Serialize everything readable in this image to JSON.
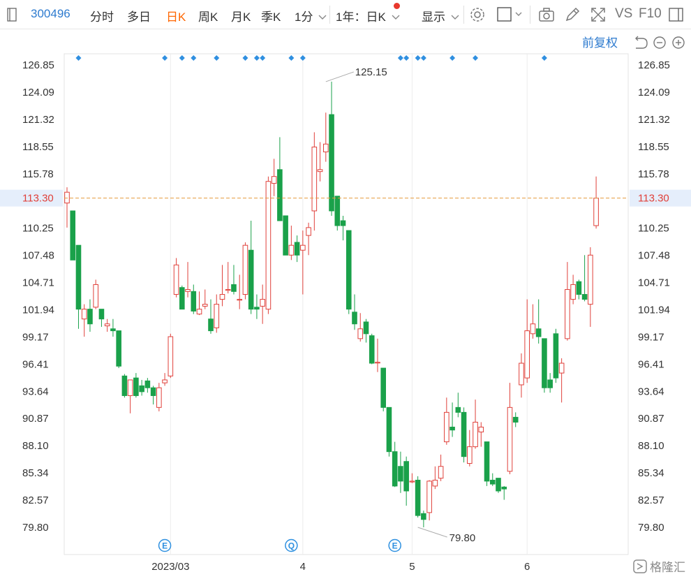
{
  "toolbar": {
    "code": "300496",
    "tabs": [
      "分时",
      "多日",
      "日K",
      "周K",
      "月K",
      "季K"
    ],
    "active_tab": "日K",
    "minute_select": "1分",
    "range_select": "1年：日K",
    "display_label": "显示",
    "vs_label": "VS",
    "f10_label": "F10",
    "icons": [
      "settings-icon",
      "checkbox-icon",
      "camera-icon",
      "pen-icon",
      "expand-icon",
      "panel-icon"
    ]
  },
  "chart_header": {
    "adjust_label": "前复权",
    "icons": [
      "undo-icon",
      "zoom-out-icon",
      "zoom-in-icon"
    ]
  },
  "colors": {
    "up": "#e0403a",
    "down": "#1aa14a",
    "price_line": "#e49b3d",
    "marker": "#2f8fe0",
    "event": "#2e90e0"
  },
  "chart_data": {
    "type": "candlestick",
    "title": "",
    "y_ticks": [
      "126.85",
      "124.09",
      "121.32",
      "118.55",
      "115.78",
      "113.30",
      "110.25",
      "107.48",
      "104.71",
      "101.94",
      "99.17",
      "96.41",
      "93.64",
      "90.87",
      "88.10",
      "85.34",
      "82.57",
      "79.80"
    ],
    "ylim": [
      79.8,
      126.85
    ],
    "x_ticks": [
      {
        "label": "2023/03",
        "index": 18
      },
      {
        "label": "4",
        "index": 41
      },
      {
        "label": "5",
        "index": 60
      },
      {
        "label": "6",
        "index": 80
      }
    ],
    "current_price": "113.30",
    "max_label": "125.15",
    "max_index": 45,
    "min_label": "79.80",
    "min_index": 61,
    "event_markers": [
      {
        "index": 17,
        "label": "E"
      },
      {
        "index": 39,
        "label": "Q"
      },
      {
        "index": 57,
        "label": "E"
      }
    ],
    "top_markers": [
      2,
      17,
      20,
      22,
      26,
      31,
      33,
      34,
      39,
      41,
      58,
      59,
      61,
      62,
      67,
      71,
      83
    ],
    "candles": [
      [
        112.8,
        113.9,
        114.4,
        110.3
      ],
      [
        112.0,
        107.0,
        112.0,
        107.0
      ],
      [
        108.5,
        102.0,
        108.5,
        100.0
      ],
      [
        101.0,
        102.0,
        102.5,
        99.2
      ],
      [
        102.0,
        100.5,
        103.0,
        99.7
      ],
      [
        102.2,
        104.5,
        105.0,
        102.0
      ],
      [
        102.0,
        101.0,
        102.0,
        100.2
      ],
      [
        100.3,
        100.5,
        101.0,
        99.7
      ],
      [
        100.0,
        99.8,
        101.0,
        99.2
      ],
      [
        99.8,
        96.2,
        99.8,
        96.0
      ],
      [
        95.2,
        93.2,
        95.4,
        93.0
      ],
      [
        93.2,
        94.8,
        94.8,
        91.4
      ],
      [
        95.0,
        93.2,
        95.5,
        93.0
      ],
      [
        94.2,
        93.6,
        94.8,
        93.2
      ],
      [
        94.7,
        94.0,
        95.0,
        93.5
      ],
      [
        94.0,
        93.2,
        94.2,
        92.3
      ],
      [
        92.0,
        94.0,
        94.5,
        91.6
      ],
      [
        94.5,
        94.8,
        95.5,
        94.2
      ],
      [
        95.2,
        99.2,
        99.5,
        95.0
      ],
      [
        103.5,
        106.5,
        107.2,
        103.2
      ],
      [
        104.2,
        102.0,
        104.4,
        102.0
      ],
      [
        103.8,
        104.0,
        106.8,
        103.2
      ],
      [
        103.8,
        101.8,
        104.5,
        101.5
      ],
      [
        101.5,
        102.0,
        103.8,
        101.4
      ],
      [
        102.3,
        102.5,
        104.0,
        102.0
      ],
      [
        101.0,
        99.8,
        103.0,
        99.5
      ],
      [
        100.1,
        102.5,
        103.5,
        99.6
      ],
      [
        103.0,
        103.5,
        106.5,
        102.3
      ],
      [
        104.0,
        104.0,
        106.8,
        103.6
      ],
      [
        104.5,
        103.8,
        106.5,
        103.5
      ],
      [
        103.0,
        103.0,
        105.5,
        102.0
      ],
      [
        103.5,
        108.5,
        108.8,
        103.0
      ],
      [
        108.0,
        102.0,
        111.0,
        101.5
      ],
      [
        102.2,
        102.0,
        103.5,
        101.0
      ],
      [
        102.3,
        103.0,
        104.5,
        100.5
      ],
      [
        102.0,
        115.0,
        115.5,
        101.5
      ],
      [
        114.8,
        115.5,
        117.3,
        113.5
      ],
      [
        116.2,
        111.0,
        119.5,
        111.0
      ],
      [
        111.5,
        107.5,
        111.5,
        107.5
      ],
      [
        107.5,
        108.5,
        110.5,
        107.0
      ],
      [
        108.8,
        107.5,
        109.5,
        106.8
      ],
      [
        108.0,
        108.5,
        110.0,
        103.5
      ],
      [
        109.5,
        110.3,
        110.8,
        107.5
      ],
      [
        112.0,
        118.5,
        120.0,
        110.0
      ],
      [
        116.0,
        116.2,
        119.0,
        115.0
      ],
      [
        118.0,
        118.8,
        122.0,
        117.0
      ],
      [
        121.8,
        112.0,
        125.15,
        111.5
      ],
      [
        113.5,
        110.5,
        113.5,
        110.0
      ],
      [
        111.0,
        110.5,
        111.5,
        109.0
      ],
      [
        110.0,
        102.0,
        110.0,
        101.5
      ],
      [
        101.7,
        100.5,
        103.5,
        99.9
      ],
      [
        99.0,
        100.0,
        101.6,
        98.7
      ],
      [
        100.7,
        99.5,
        101.0,
        98.6
      ],
      [
        99.3,
        96.5,
        99.5,
        96.4
      ],
      [
        96.6,
        96.6,
        99.0,
        95.6
      ],
      [
        96.0,
        92.0,
        96.0,
        91.6
      ],
      [
        92.0,
        87.5,
        92.0,
        87.0
      ],
      [
        87.5,
        84.0,
        88.5,
        83.9
      ],
      [
        86.0,
        84.5,
        87.5,
        83.3
      ],
      [
        86.5,
        83.5,
        87.0,
        82.0
      ],
      [
        84.5,
        84.5,
        85.3,
        84.3
      ],
      [
        84.6,
        81.0,
        85.0,
        80.8
      ],
      [
        81.2,
        80.6,
        81.5,
        79.8
      ],
      [
        81.3,
        84.5,
        84.6,
        80.5
      ],
      [
        84.0,
        84.6,
        86.0,
        83.7
      ],
      [
        84.8,
        86.0,
        87.2,
        84.5
      ],
      [
        88.5,
        91.5,
        93.0,
        88.2
      ],
      [
        90.0,
        89.7,
        92.5,
        89.0
      ],
      [
        92.0,
        91.5,
        93.5,
        91.0
      ],
      [
        91.5,
        87.0,
        92.0,
        86.4
      ],
      [
        86.3,
        88.0,
        89.7,
        86.0
      ],
      [
        88.0,
        90.5,
        92.8,
        87.8
      ],
      [
        89.5,
        90.0,
        90.5,
        88.0
      ],
      [
        88.5,
        84.5,
        88.5,
        84.0
      ],
      [
        84.6,
        84.2,
        85.3,
        84.0
      ],
      [
        84.8,
        83.5,
        84.8,
        83.3
      ],
      [
        83.9,
        83.7,
        84.0,
        82.6
      ],
      [
        85.5,
        92.0,
        94.5,
        85.2
      ],
      [
        91.0,
        90.5,
        91.5,
        90.0
      ],
      [
        94.3,
        96.5,
        97.5,
        93.0
      ],
      [
        95.0,
        99.8,
        103.0,
        94.5
      ],
      [
        99.5,
        100.5,
        102.5,
        99.0
      ],
      [
        100.0,
        99.2,
        103.0,
        98.5
      ],
      [
        99.0,
        94.0,
        99.0,
        93.5
      ],
      [
        94.8,
        94.0,
        95.5,
        93.5
      ],
      [
        99.5,
        95.0,
        100.0,
        94.5
      ],
      [
        95.5,
        96.5,
        97.0,
        92.5
      ],
      [
        99.0,
        104.0,
        106.8,
        98.8
      ],
      [
        103.0,
        104.5,
        105.5,
        102.5
      ],
      [
        104.8,
        103.5,
        105.0,
        103.0
      ],
      [
        103.5,
        103.0,
        107.5,
        102.8
      ],
      [
        102.5,
        107.5,
        108.3,
        100.2
      ],
      [
        110.5,
        113.3,
        115.5,
        110.2
      ]
    ]
  },
  "watermark": {
    "text": "格隆汇"
  }
}
